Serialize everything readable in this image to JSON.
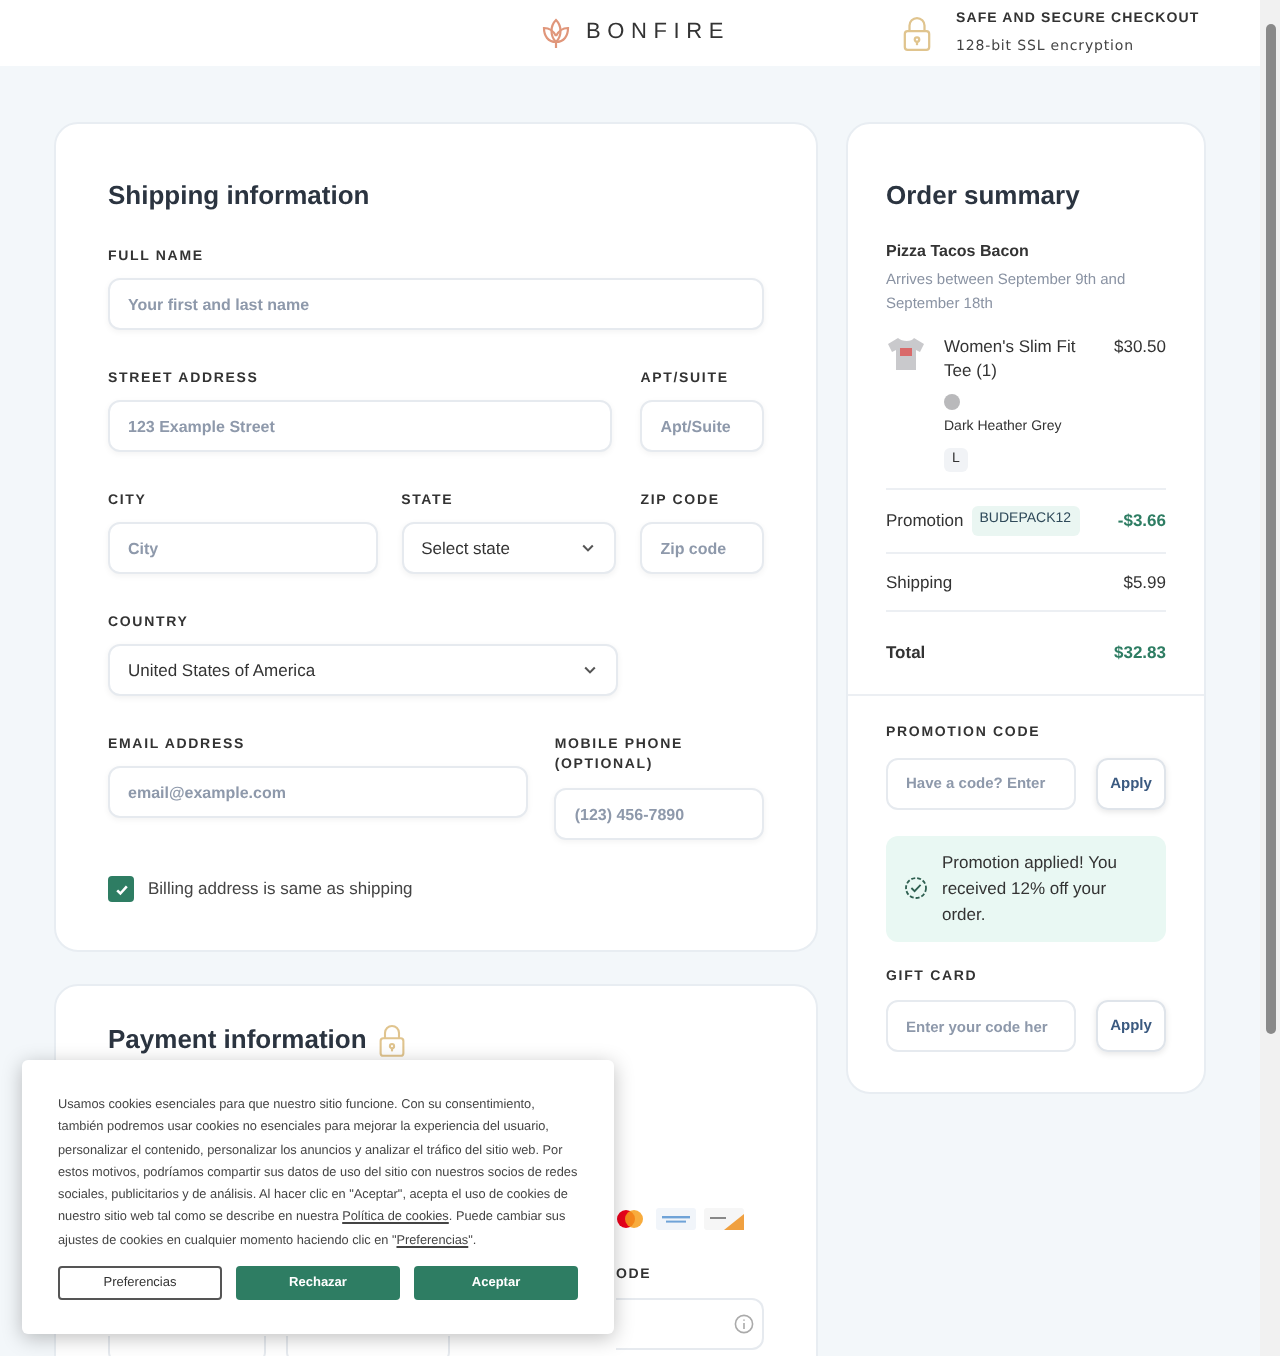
{
  "header": {
    "logo_text": "BONFIRE",
    "security_title": "SAFE AND SECURE CHECKOUT",
    "security_subtitle": "128-bit SSL encryption"
  },
  "shipping": {
    "title": "Shipping information",
    "fields": [
      {
        "label": "FULL NAME",
        "kind": "input",
        "placeholder": "Your first and last name"
      },
      {
        "label": "STREET ADDRESS",
        "kind": "input",
        "placeholder": "123 Example Street"
      },
      {
        "label": "APT/SUITE",
        "kind": "input",
        "placeholder": "Apt/Suite"
      },
      {
        "label": "CITY",
        "kind": "input",
        "placeholder": "City"
      },
      {
        "label": "STATE",
        "kind": "select",
        "value": "Select state"
      },
      {
        "label": "ZIP CODE",
        "kind": "input",
        "placeholder": "Zip code"
      },
      {
        "label": "COUNTRY",
        "kind": "select",
        "value": "United States of America"
      },
      {
        "label": "EMAIL ADDRESS",
        "kind": "input",
        "placeholder": "email@example.com"
      },
      {
        "label": "MOBILE PHONE (OPTIONAL)",
        "kind": "input",
        "placeholder": "(123) 456-7890"
      }
    ],
    "billing_same": {
      "label": "Billing address is same as shipping",
      "checked": true
    }
  },
  "payment": {
    "title": "Payment information",
    "label_fragment": "ODE"
  },
  "order_summary": {
    "title": "Order summary",
    "shop": "Pizza Tacos Bacon",
    "arrival": "Arrives between September 9th and September 18th",
    "item": {
      "name": "Women's Slim Fit Tee (1)",
      "price": "$30.50",
      "color_name": "Dark Heather Grey",
      "size": "L"
    },
    "lines": [
      {
        "kind": "promo",
        "label": "Promotion",
        "code": "BUDEPACK12",
        "amount": "-$3.66"
      },
      {
        "kind": "normal",
        "label": "Shipping",
        "amount": "$5.99"
      },
      {
        "kind": "total",
        "label": "Total",
        "amount": "$32.83"
      }
    ]
  },
  "promotion": {
    "label": "PROMOTION CODE",
    "placeholder": "Have a code? Enter",
    "button": "Apply",
    "message": "Promotion applied! You received 12% off your order."
  },
  "gift_card": {
    "label": "GIFT CARD",
    "placeholder": "Enter your code her",
    "button": "Apply"
  },
  "cookie_banner": {
    "text_before": "Usamos cookies esenciales para que nuestro sitio funcione. Con su consentimiento, también podremos usar cookies no esenciales para mejorar la experiencia del usuario, personalizar el contenido, personalizar los anuncios y analizar el tráfico del sitio web. Por estos motivos, podríamos compartir sus datos de uso del sitio con nuestros socios de redes sociales, publicitarios y de análisis. Al hacer clic en \"Aceptar\", acepta el uso de cookies de nuestro sitio web tal como se describe en nuestra ",
    "link1": "Política de cookies",
    "text_middle": ". Puede cambiar sus ajustes de cookies en cualquier momento haciendo clic en \"",
    "link2": "Preferencias",
    "text_after": "\".",
    "buttons": [
      {
        "label": "Preferencias",
        "kind": "outline"
      },
      {
        "label": "Rechazar",
        "kind": "filled"
      },
      {
        "label": "Aceptar",
        "kind": "filled"
      }
    ]
  }
}
